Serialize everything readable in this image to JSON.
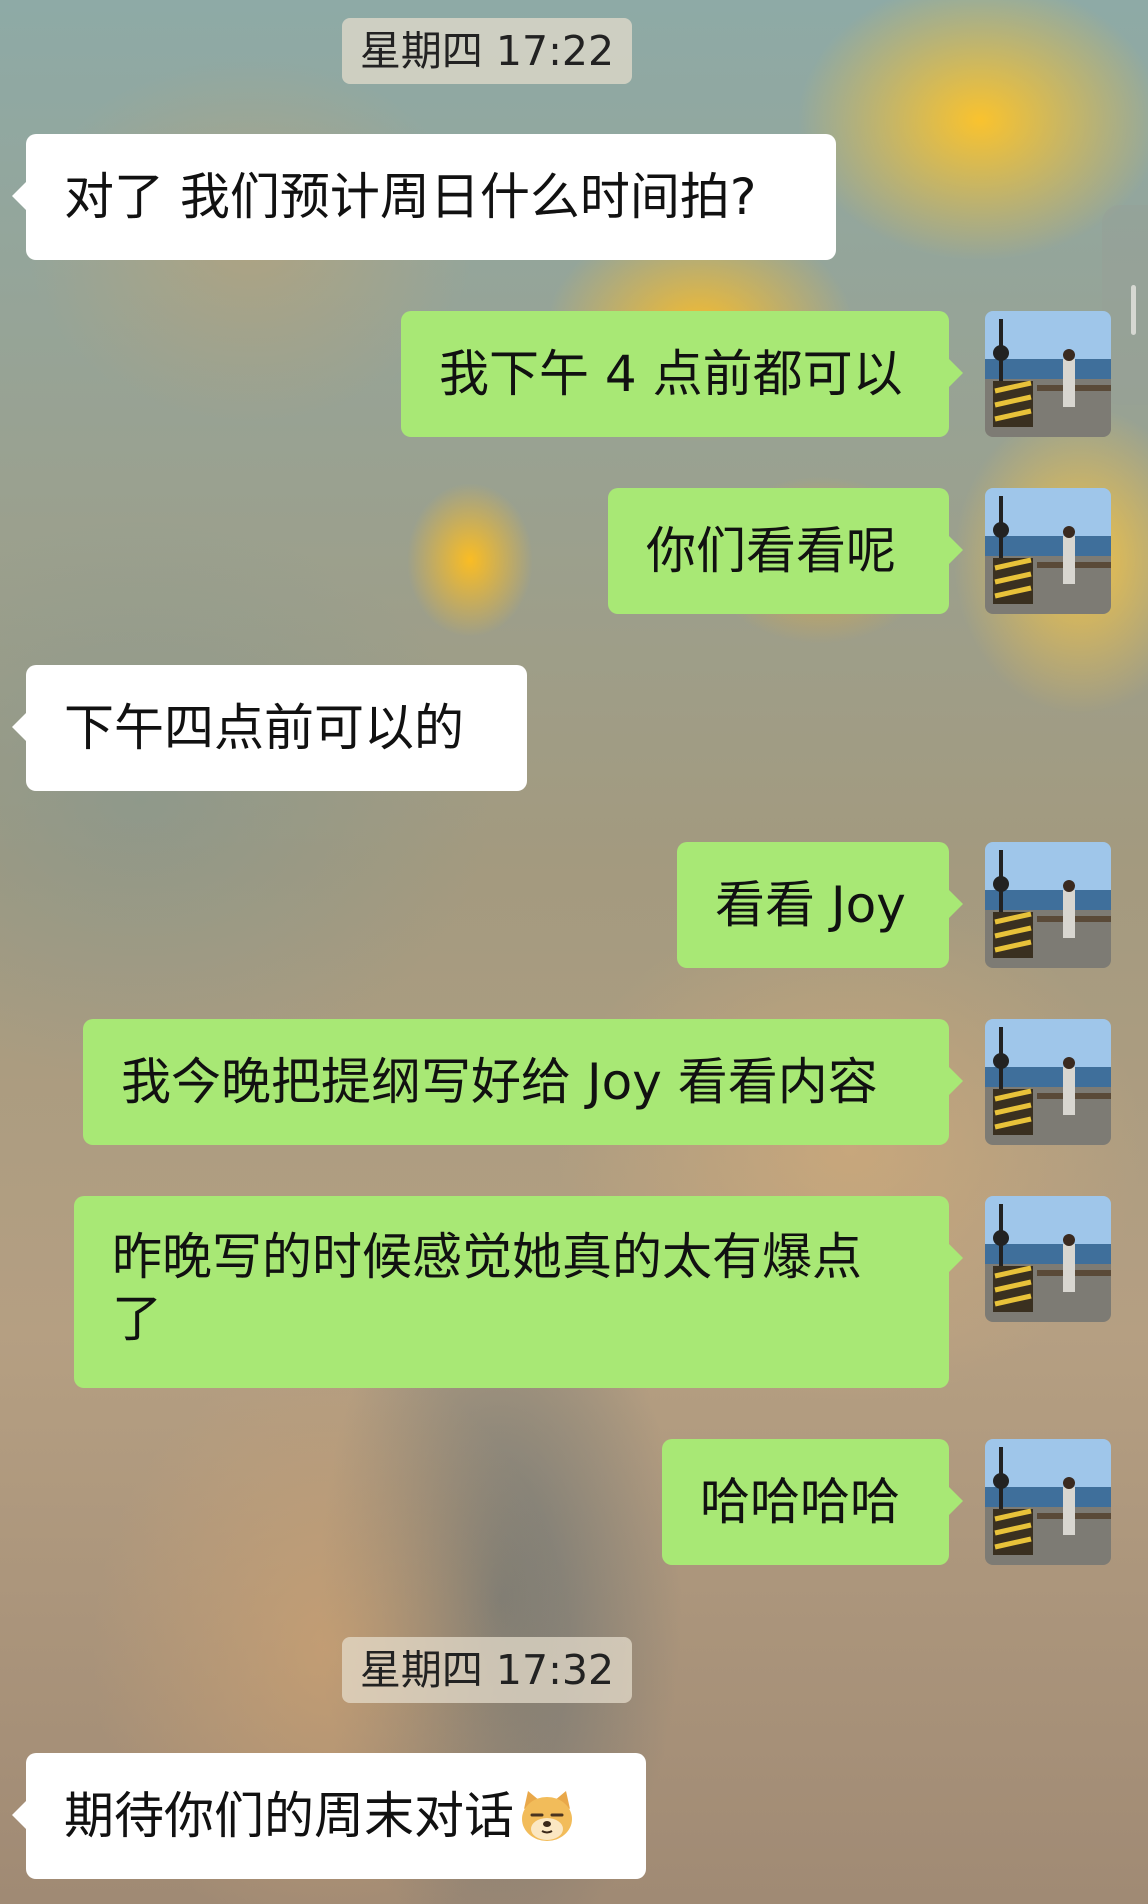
{
  "timestamps": [
    {
      "text": "星期四 17:22"
    },
    {
      "text": "星期四 17:32"
    }
  ],
  "messages": [
    {
      "side": "left",
      "text": "对了 我们预计周日什么时间拍?"
    },
    {
      "side": "right",
      "text": "我下午 4 点前都可以"
    },
    {
      "side": "right",
      "text": "你们看看呢"
    },
    {
      "side": "left",
      "text": "下午四点前可以的"
    },
    {
      "side": "right",
      "text": "看看 Joy"
    },
    {
      "side": "right",
      "text": "我今晚把提纲写好给 Joy 看看内容"
    },
    {
      "side": "right",
      "text": "昨晚写的时候感觉她真的太有爆点了"
    },
    {
      "side": "right",
      "text": "哈哈哈哈"
    },
    {
      "side": "left",
      "text": "期待你们的周末对话",
      "emoji": "doge-face-emoji"
    }
  ],
  "colors": {
    "outgoing_bubble": "#a8e875",
    "incoming_bubble": "#ffffff",
    "timestamp_bg": "#e6decd"
  }
}
